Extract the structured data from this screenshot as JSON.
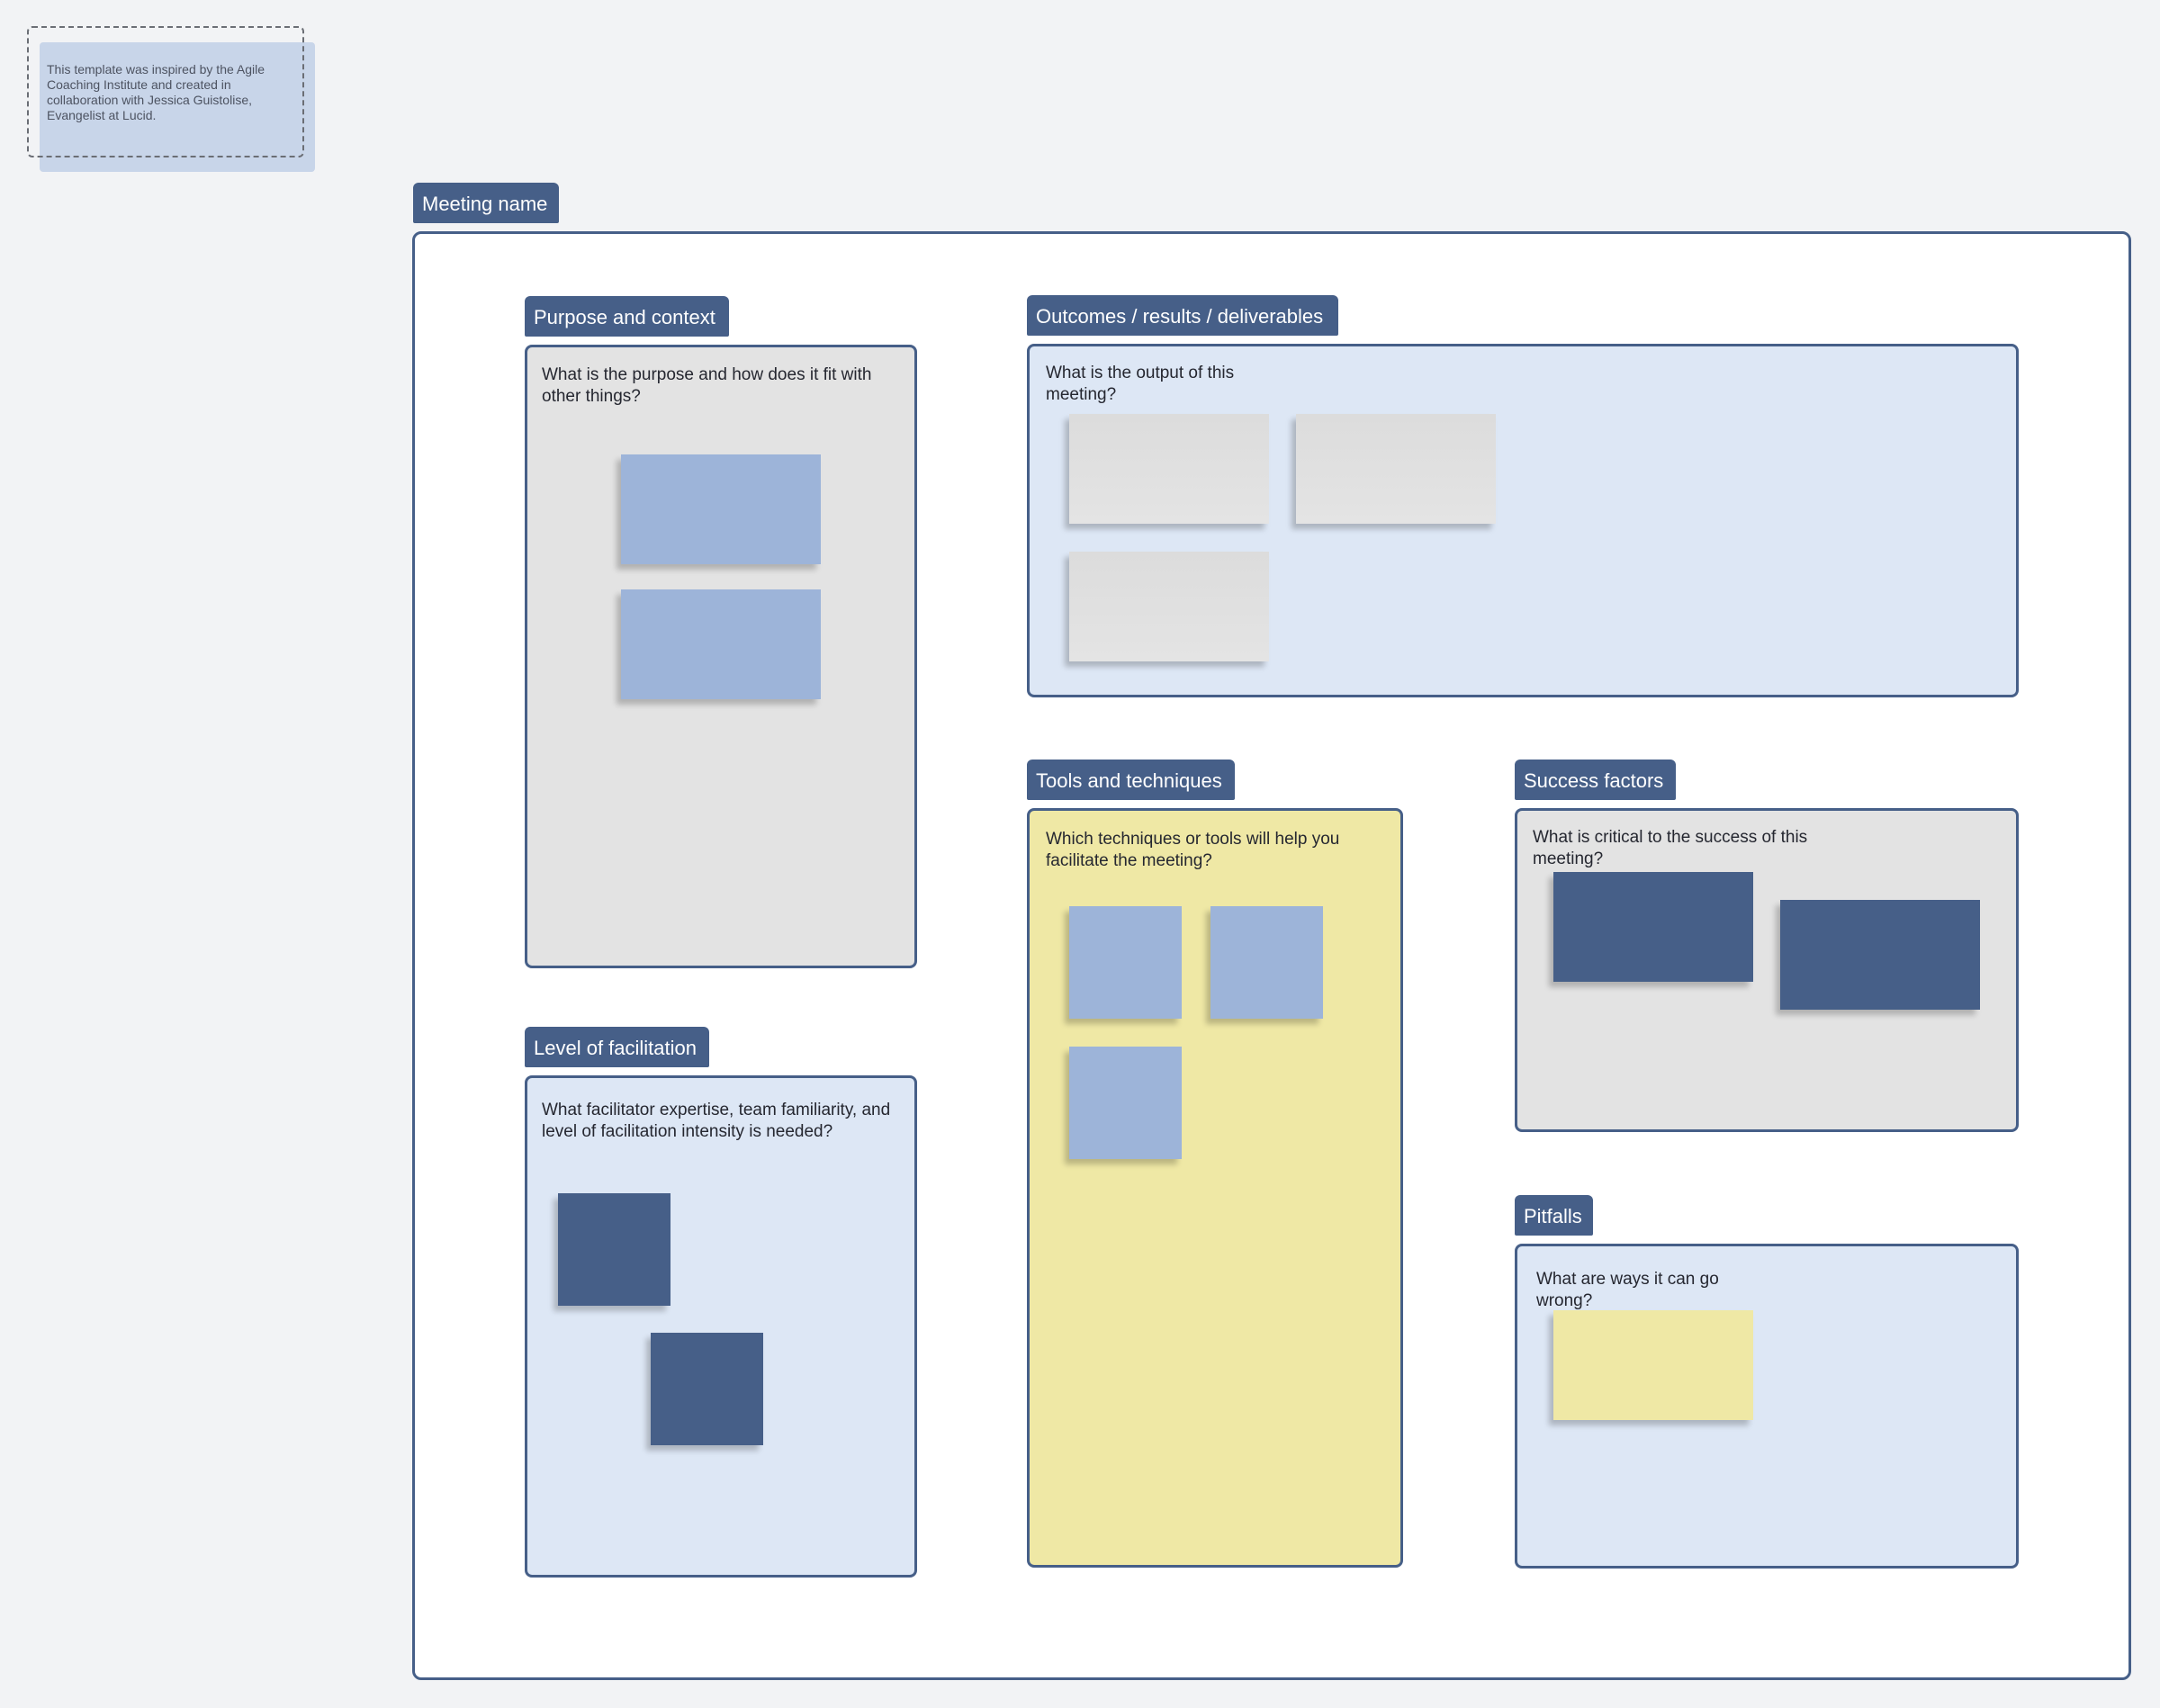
{
  "note": {
    "text": "This template was inspired by the Agile Coaching Institute and created in collaboration with Jessica Guistolise, Evangelist at Lucid."
  },
  "meeting": {
    "tab_label": "Meeting name"
  },
  "sections": {
    "purpose": {
      "tab_label": "Purpose and context",
      "prompt": "What is the purpose and how does it fit with other things?"
    },
    "outcomes": {
      "tab_label": "Outcomes / results / deliverables",
      "prompt": "What is the output of this meeting?"
    },
    "facilitation": {
      "tab_label": "Level of facilitation",
      "prompt": "What facilitator expertise, team familiarity, and level of facilitation intensity is needed?"
    },
    "tools": {
      "tab_label": "Tools and techniques",
      "prompt": "Which techniques or tools will help you facilitate the meeting?"
    },
    "success": {
      "tab_label": "Success factors",
      "prompt": "What is critical to the success of this meeting?"
    },
    "pitfalls": {
      "tab_label": "Pitfalls",
      "prompt": "What are ways it can go wrong?"
    }
  },
  "colors": {
    "accent": "#465f88",
    "sticky_blue": "#9db4d9",
    "sticky_yellow": "#efe8a5",
    "panel_gray": "#e3e3e3",
    "panel_blue": "#dde7f5"
  }
}
